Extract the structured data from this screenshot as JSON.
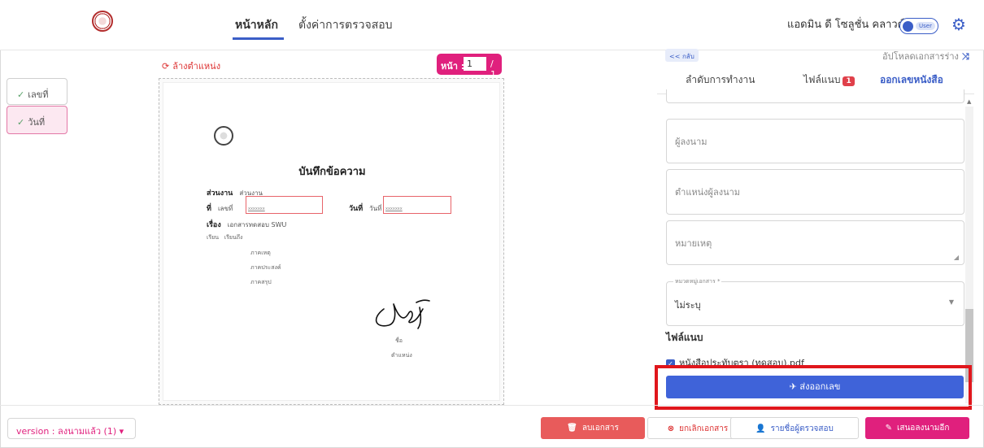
{
  "header": {
    "nav": [
      "หน้าหลัก",
      "ตั้งค่าการตรวจสอบ"
    ],
    "user_name": "แอดมิน ดี โซลูชั่น คลาวด์",
    "toggle_label": "User",
    "accent": "#3b5ec7"
  },
  "left_checklist": [
    "เลขที่",
    "วันที่"
  ],
  "document": {
    "reset_label": "ล้างตำแหน่ง",
    "page_label": "หน้า :",
    "page_current": "1",
    "page_total": "/ 1",
    "title": "บันทึกข้อความ",
    "dept_label": "ส่วนงาน",
    "dept_value": "ส่วนงาน",
    "no_label": "ที่",
    "no_value": "เลขที่",
    "date_label": "วันที่",
    "date_value": "วันที่",
    "placeholder_box": "xxxxxxx",
    "subject_label": "เรื่อง",
    "subject_value": "เอกสารทดสอบ SWU",
    "to_label": "เรียน",
    "to_value": "เรียนถึง",
    "lines": [
      "ภาคเหตุ",
      "ภาคประสงค์",
      "ภาคสรุป"
    ],
    "sign_name": "ชื่อ",
    "sign_position": "ตำแหน่ง"
  },
  "right_panel": {
    "back_label": "<< กลับ",
    "upload_label": "อัปโหลดเอกสารร่าง",
    "tabs": [
      {
        "label": "ลำดับการทำงาน"
      },
      {
        "label": "ไฟล์แนบ",
        "badge": "1"
      },
      {
        "label": "ออกเลขหนังสือ"
      }
    ],
    "fields": {
      "signer": "ผู้ลงนาม",
      "signer_position": "ตำแหน่งผู้ลงนาม",
      "note": "หมายเหตุ",
      "category_label": "หมวดหมู่เอกสาร *",
      "category_value": "ไม่ระบุ"
    },
    "attachments_title": "ไฟล์แนบ",
    "attachment_file": "หนังสือประทับตรา (ทดสอบ).pdf",
    "send_button": "ส่งออกเลข"
  },
  "footer": {
    "version": "version : ลงนามแล้ว (1)",
    "delete": "ลบเอกสาร",
    "cancel": "ยกเลิกเอกสาร",
    "reviewers": "รายชื่อผู้ตรวจสอบ",
    "propose": "เสนอลงนามอีก"
  }
}
